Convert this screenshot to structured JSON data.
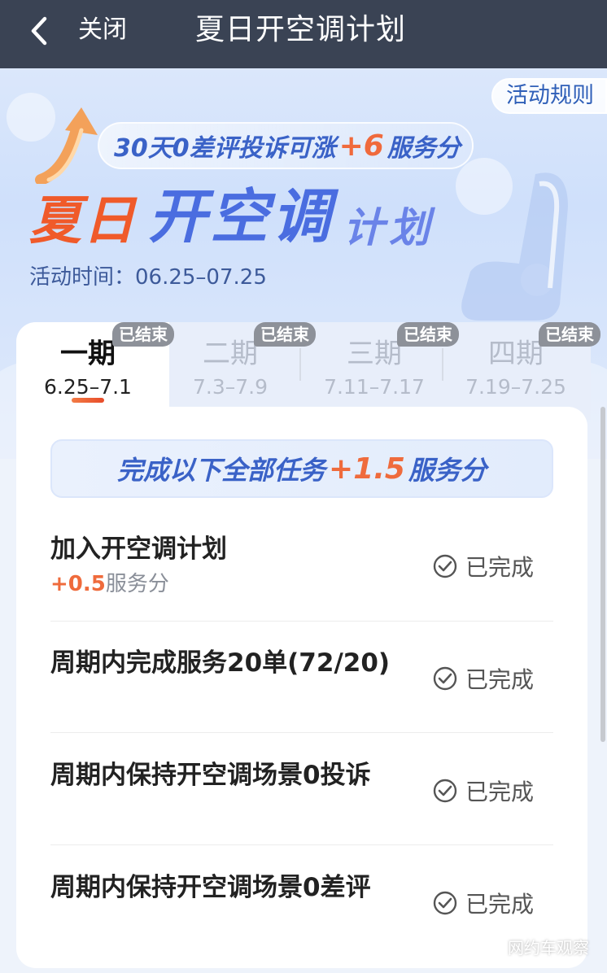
{
  "nav": {
    "close_label": "关闭",
    "title": "夏日开空调计划"
  },
  "hero": {
    "rules_label": "活动规则",
    "promo_prefix": "30天0差评投诉可涨",
    "promo_value": "+6",
    "promo_suffix": "服务分",
    "title_part1": "夏日",
    "title_part2": "开空调",
    "title_part3": "计划",
    "activity_time": "活动时间：06.25–07.25"
  },
  "tabs": [
    {
      "name": "一期",
      "range": "6.25–7.1",
      "badge": "已结束",
      "active": true
    },
    {
      "name": "二期",
      "range": "7.3–7.9",
      "badge": "已结束",
      "active": false
    },
    {
      "name": "三期",
      "range": "7.11–7.17",
      "badge": "已结束",
      "active": false
    },
    {
      "name": "四期",
      "range": "7.19–7.25",
      "badge": "已结束",
      "active": false
    }
  ],
  "summary": {
    "prefix": "完成以下全部任务",
    "value": "+1.5",
    "suffix": "服务分"
  },
  "tasks": [
    {
      "title": "加入开空调计划",
      "reward_value": "+0.5",
      "reward_unit": "服务分",
      "status": "已完成"
    },
    {
      "title": "周期内完成服务20单(72/20)",
      "status": "已完成"
    },
    {
      "title": "周期内保持开空调场景0投诉",
      "status": "已完成"
    },
    {
      "title": "周期内保持开空调场景0差评",
      "status": "已完成"
    }
  ],
  "watermark": "网约车观察",
  "colors": {
    "accent_blue": "#3a62c7",
    "accent_orange": "#ef6b3c",
    "nav_bg": "#3a4354"
  }
}
